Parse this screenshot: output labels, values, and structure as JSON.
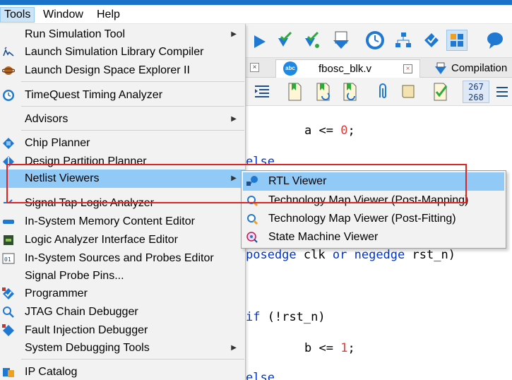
{
  "menubar": {
    "tools": "Tools",
    "window": "Window",
    "help": "Help"
  },
  "tools_menu": {
    "items": [
      {
        "label": "Run Simulation Tool",
        "icon": "none",
        "submenu": true
      },
      {
        "label": "Launch Simulation Library Compiler",
        "icon": "sim-library-icon"
      },
      {
        "label": "Launch Design Space Explorer II",
        "icon": "dse-icon"
      },
      {
        "label": "TimeQuest Timing Analyzer",
        "icon": "timequest-clock-icon"
      },
      {
        "label": "Advisors",
        "icon": "none",
        "submenu": true
      },
      {
        "label": "Chip Planner",
        "icon": "chip-planner-icon"
      },
      {
        "label": "Design Partition Planner",
        "icon": "partition-planner-icon"
      },
      {
        "label": "Netlist Viewers",
        "icon": "none",
        "submenu": true,
        "highlighted": true
      },
      {
        "label": "Signal Tap Logic Analyzer",
        "icon": "signal-tap-icon"
      },
      {
        "label": "In-System Memory Content Editor",
        "icon": "memory-editor-icon"
      },
      {
        "label": "Logic Analyzer Interface Editor",
        "icon": "lai-editor-icon"
      },
      {
        "label": "In-System Sources and Probes Editor",
        "icon": "sources-probes-icon"
      },
      {
        "label": "Signal Probe Pins...",
        "icon": "none"
      },
      {
        "label": "Programmer",
        "icon": "programmer-icon"
      },
      {
        "label": "JTAG Chain Debugger",
        "icon": "jtag-debugger-icon"
      },
      {
        "label": "Fault Injection Debugger",
        "icon": "fault-injection-icon"
      },
      {
        "label": "System Debugging Tools",
        "icon": "none",
        "submenu": true
      },
      {
        "label": "IP Catalog",
        "icon": "ip-catalog-icon"
      }
    ]
  },
  "netlist_submenu": {
    "items": [
      {
        "label": "RTL Viewer",
        "icon": "rtl-viewer-icon",
        "highlighted": true
      },
      {
        "label": "Technology Map Viewer (Post-Mapping)",
        "icon": "tech-map-icon"
      },
      {
        "label": "Technology Map Viewer (Post-Fitting)",
        "icon": "tech-map-icon"
      },
      {
        "label": "State Machine Viewer",
        "icon": "state-machine-icon"
      }
    ]
  },
  "tabs": {
    "file": "fbosc_blk.v",
    "compilation": "Compilation",
    "file_icon": "abc"
  },
  "line_counter": {
    "line1": "267",
    "line2": "268"
  },
  "code": {
    "line_a_var": "a",
    "line_a_op": "<=",
    "line_a_val": "0",
    "line_a_end": ";",
    "else1": "else",
    "posedge": "posedge",
    "clk": "clk",
    "or": "or",
    "negedge": "negedge",
    "rst_close": "rst_n)",
    "if": "if",
    "if_cond": "(!rst_n)",
    "line_b_var": "b",
    "line_b_op": "<=",
    "line_b_val": "1",
    "line_b_end": ";",
    "else2": "else"
  },
  "colors": {
    "keyword": "#0033cc",
    "number": "#e53935",
    "highlight": "#91c9f7",
    "annotation_box": "#e02424"
  }
}
